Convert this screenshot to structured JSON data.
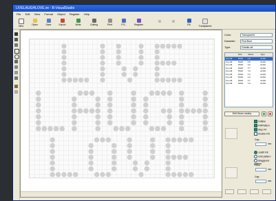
{
  "window": {
    "title": "LIVELAUGHLOVE.ve - B-VisualStudio"
  },
  "menu": [
    "File",
    "Edit",
    "View",
    "Format",
    "Object",
    "Register",
    "Help"
  ],
  "toolbar": {
    "buttons": [
      "New",
      "Open",
      "Save",
      "Export",
      "Write",
      "Cutting",
      "Print",
      "P.S.",
      "Register"
    ],
    "right_buttons": [
      "Fill",
      "Transparent"
    ]
  },
  "canvas": {
    "words": [
      "LIVE",
      "LAUGH",
      "LOVE"
    ],
    "dot_color": "#d0d0d0"
  },
  "panel": {
    "color_label": "Color:",
    "color_value": "Transparent",
    "diameter_label": "Diameter:",
    "diameter_value": "Find Bore",
    "type_label": "Type:",
    "type_value": "Granite-all",
    "list": {
      "headers": [
        "",
        "Size",
        "Diame",
        "Type"
      ],
      "rows": [
        [
          "Cry-Hlt",
          "SS16",
          "3.8",
          "Acrilic"
        ],
        [
          "Cry-Hlt",
          "SS16",
          "3.8",
          "Acrilic"
        ],
        [
          "Cry-Hlt",
          "SS16",
          "8.0",
          "Acrilic"
        ],
        [
          "Cry-Hlt",
          "SS16",
          "8.7",
          "Acrilic"
        ],
        [
          "Cry-Hlt",
          "SS16",
          "7.0",
          "Acrilic"
        ],
        [
          "Cry-Hlt",
          "SS16",
          "8.4",
          "Acrilic"
        ],
        [
          "Cry-Hlt",
          "SS16",
          "9.0",
          "Acrilic"
        ],
        [
          "Cry-Hlt",
          "SS16",
          "8.7",
          "Acrilic"
        ],
        [
          "Cry-Hlt",
          "SS16",
          "7.0",
          "Acrilic"
        ]
      ]
    },
    "edit_button": "Edit Stone variety",
    "checkboxes": [
      "Outline",
      "Fill/Pattern",
      "Stop Fit",
      "Double Fill"
    ],
    "gap_label": "Gap",
    "gap_unit": "mm",
    "radio": [
      "Justifi Fill",
      "Grid pattern",
      "Staggered pattern"
    ],
    "pitch_label": "Pitch",
    "pitch_unit": "mm",
    "gap2_label": "Gap",
    "gap2_unit": "mm"
  }
}
